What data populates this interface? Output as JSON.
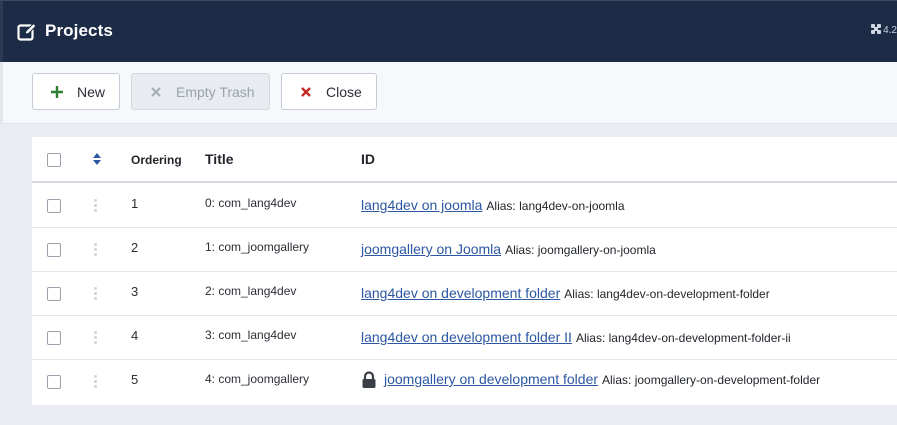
{
  "header": {
    "title": "Projects",
    "version": "4.2"
  },
  "toolbar": {
    "new_label": "New",
    "empty_trash_label": "Empty Trash",
    "close_label": "Close"
  },
  "table": {
    "columns": {
      "ordering": "Ordering",
      "title": "Title",
      "id": "ID"
    },
    "rows": [
      {
        "ordering": "1",
        "title": "0: com_lang4dev",
        "link": " lang4dev on joomla",
        "alias": "Alias: lang4dev-on-joomla",
        "locked": false
      },
      {
        "ordering": "2",
        "title": "1: com_joomgallery",
        "link": " joomgallery on Joomla",
        "alias": "Alias: joomgallery-on-joomla",
        "locked": false
      },
      {
        "ordering": "3",
        "title": "2: com_lang4dev",
        "link": " lang4dev on development folder",
        "alias": "Alias: lang4dev-on-development-folder",
        "locked": false
      },
      {
        "ordering": "4",
        "title": "3: com_lang4dev",
        "link": " lang4dev on development folder II",
        "alias": "Alias: lang4dev-on-development-folder-ii",
        "locked": false
      },
      {
        "ordering": "5",
        "title": "4: com_joomgallery",
        "link": "joomgallery on development folder",
        "alias": "Alias: joomgallery-on-development-folder",
        "locked": true
      }
    ]
  },
  "colors": {
    "header_bg": "#1c2b46",
    "link": "#2c57a3",
    "new_icon": "#2e7d32",
    "close_icon": "#c62828",
    "sort_icon": "#2c57a3"
  },
  "icons": {
    "title": "edit-icon",
    "version": "joomla-logo-icon",
    "new": "plus-icon",
    "empty_trash": "x-icon",
    "close": "x-icon",
    "sort": "sort-icon",
    "drag": "drag-handle-icon",
    "locked": "lock-icon"
  }
}
